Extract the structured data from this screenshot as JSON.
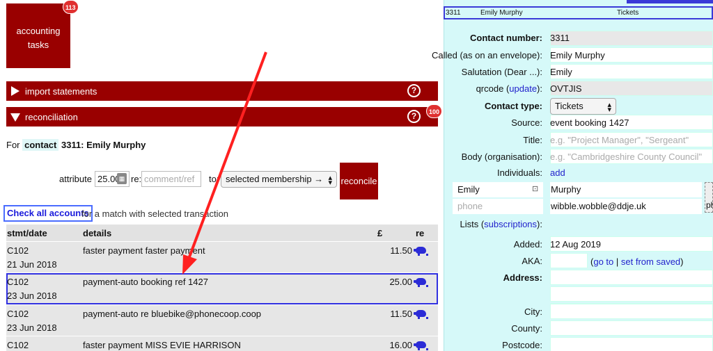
{
  "accounting_tile": {
    "label": "accounting\ntasks",
    "badge": "113"
  },
  "sections": {
    "import": {
      "label": "import statements",
      "help": "?"
    },
    "reconciliation": {
      "label": "reconciliation",
      "help": "?",
      "badge": "100"
    }
  },
  "for_line": {
    "prefix": "For",
    "tag": "contact",
    "name": "3311: Emily Murphy"
  },
  "attribute_form": {
    "label_attribute": "attribute £",
    "amount_value": "25.00",
    "label_re": "re:",
    "ref_placeholder": "comment/ref",
    "label_to": "to:",
    "selected_option": "selected membership →",
    "reconcile_label": "reconcile"
  },
  "check_accounts": {
    "button_label": "Check all accounts",
    "note": "for a match with selected transaction"
  },
  "table": {
    "columns": [
      "stmt/date",
      "details",
      "£",
      "re"
    ],
    "rows": [
      {
        "stmt_date": "C102\n21 Jun 2018",
        "details": "faster payment faster payment",
        "amount": "11.50"
      },
      {
        "stmt_date": "C102\n23 Jun 2018",
        "details": "payment-auto booking ref 1427",
        "amount": "25.00"
      },
      {
        "stmt_date": "C102\n23 Jun 2018",
        "details": "payment-auto re bluebike@phonecoop.coop",
        "amount": "11.50"
      },
      {
        "stmt_date": "C102",
        "details": "faster payment MISS EVIE HARRISON",
        "amount": "16.00"
      }
    ]
  },
  "colors": {
    "brand_red": "#990000",
    "link_blue": "#2222cc",
    "panel_cyan": "#d6f9f9",
    "selection_blue": "#3030e0"
  },
  "contact": {
    "summary": {
      "number": "3311",
      "name": "Emily Murphy",
      "type": "Tickets"
    },
    "contact_number": {
      "label": "Contact number:",
      "value": "3311"
    },
    "called": {
      "label": "Called (as on an envelope):",
      "value": "Emily Murphy"
    },
    "salutation": {
      "label": "Salutation (Dear ...):",
      "value": "Emily"
    },
    "qrcode": {
      "label_pre": "qrcode (",
      "link": "update",
      "label_post": "):",
      "value": "OVTJIS"
    },
    "contact_type": {
      "label": "Contact type:",
      "value": "Tickets"
    },
    "source": {
      "label": "Source:",
      "value": "event booking 1427"
    },
    "title": {
      "label": "Title:",
      "placeholder": "e.g. \"Project Manager\", \"Sergeant\""
    },
    "body": {
      "label": "Body (organisation):",
      "placeholder": "e.g. \"Cambridgeshire County Council\""
    },
    "individuals": {
      "label": "Individuals:",
      "link": "add"
    },
    "individual": {
      "first_name": "Emily",
      "last_name": "Murphy",
      "phone_placeholder": "phone",
      "email": "wibble.wobble@ddje.uk",
      "edge_text": "ph"
    },
    "lists": {
      "label_pre": "Lists (",
      "link": "subscriptions",
      "label_post": "):"
    },
    "added": {
      "label": "Added:",
      "value": "12 Aug 2019"
    },
    "aka": {
      "label": "AKA:",
      "goto": "go to",
      "sep": "|",
      "set_from_saved": "set from saved"
    },
    "address": {
      "label": "Address:"
    },
    "city": {
      "label": "City:"
    },
    "county": {
      "label": "County:"
    },
    "postcode": {
      "label": "Postcode:"
    }
  }
}
